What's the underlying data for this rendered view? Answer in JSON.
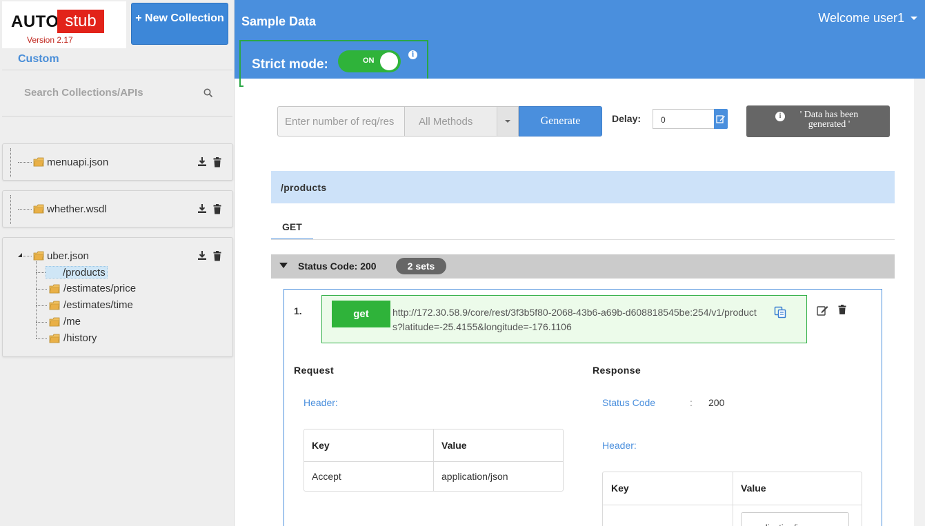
{
  "app": {
    "logo_left": "AUTO",
    "logo_right": "stub",
    "version": "Version 2.17",
    "new_collection_label": "+ New Collection"
  },
  "sidebar": {
    "section_label": "Custom",
    "search_placeholder": "Search Collections/APIs",
    "collections": [
      {
        "name": "menuapi.json",
        "apis": []
      },
      {
        "name": "whether.wsdl",
        "apis": []
      },
      {
        "name": "uber.json",
        "apis": [
          "/products",
          "/estimates/price",
          "/estimates/time",
          "/me",
          "/history"
        ],
        "selected_api": "/products"
      }
    ]
  },
  "header": {
    "title": "Sample Data",
    "welcome": "Welcome user1",
    "strict_mode_label": "Strict mode:",
    "strict_mode_state": "ON",
    "info_glyph": "i"
  },
  "toolbar": {
    "req_placeholder": "Enter number of req/res",
    "method_select": "All Methods",
    "generate_label": "Generate",
    "delay_label": "Delay:",
    "delay_value": "0",
    "toast_text": "' Data has been generated '"
  },
  "api": {
    "path": "/products",
    "tabs": [
      "GET"
    ],
    "status_code_label": "Status Code: 200",
    "sets_badge": "2 sets",
    "set": {
      "index": "1.",
      "method": "get",
      "url": "http://172.30.58.9/core/rest/3f3b5f80-2068-43b6-a69b-d608818545be:254/v1/products?latitude=-25.4155&longitude=-176.1106",
      "request": {
        "title": "Request",
        "header_label": "Header:",
        "columns": [
          "Key",
          "Value"
        ],
        "rows": [
          [
            "Accept",
            "application/json"
          ]
        ]
      },
      "response": {
        "title": "Response",
        "status_label": "Status Code",
        "status_sep": ":",
        "status_value": "200",
        "header_label": "Header:",
        "columns": [
          "Key",
          "Value"
        ],
        "partial_value": "application/js"
      }
    }
  },
  "colors": {
    "primary": "#4a8fdd",
    "success": "#2fb33a",
    "strict_border": "#2aa745",
    "brand_red": "#e2231a"
  }
}
